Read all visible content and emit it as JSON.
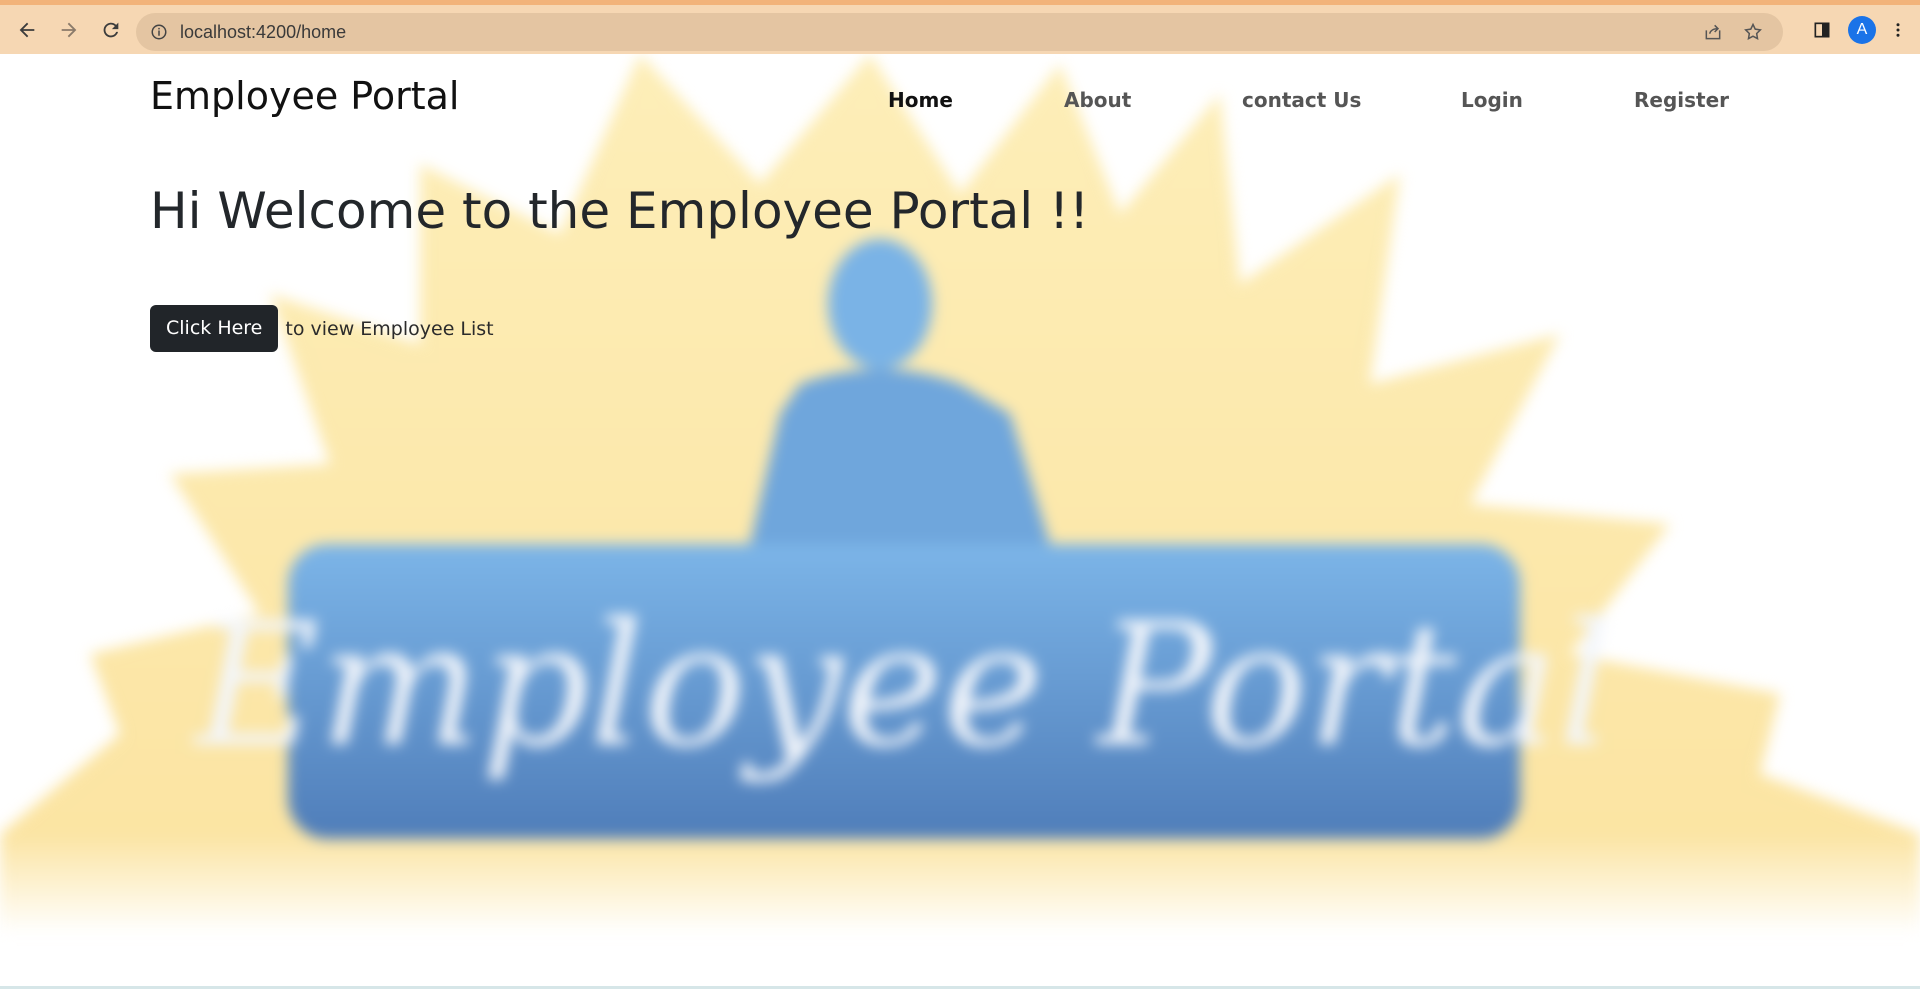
{
  "browser": {
    "url": "localhost:4200/home",
    "profile_initial": "A",
    "accent_color": "#f6d7b3"
  },
  "site": {
    "brand": "Employee Portal",
    "nav": [
      {
        "label": "Home",
        "active": true
      },
      {
        "label": "About",
        "active": false
      },
      {
        "label": "contact Us",
        "active": false
      },
      {
        "label": "Login",
        "active": false
      },
      {
        "label": "Register",
        "active": false
      }
    ]
  },
  "hero": {
    "heading": "Hi Welcome to the Employee Portal !!",
    "button_label": "Click Here",
    "button_suffix": "to view Employee List",
    "background_logo_text": "Employee Portal"
  },
  "colors": {
    "button_bg": "#212529",
    "sun_yellow": "#fbe3a3",
    "logo_blue": "#5b88c4"
  },
  "icons": [
    "back-arrow-icon",
    "forward-arrow-icon",
    "reload-icon",
    "info-icon",
    "share-icon",
    "star-icon",
    "side-panel-icon",
    "more-vertical-icon"
  ]
}
